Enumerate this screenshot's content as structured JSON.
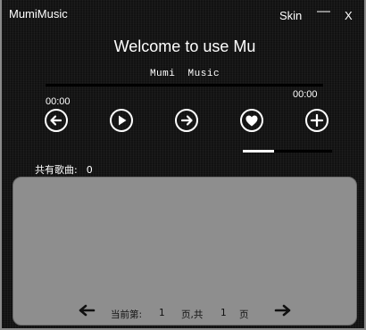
{
  "window": {
    "title": "MumiMusic",
    "skin_label": "Skin",
    "minimize_label": "—",
    "close_label": "X"
  },
  "header": {
    "welcome": "Welcome to use Mu",
    "song_title": "Mumi  Music"
  },
  "player": {
    "time_current": "00:00",
    "time_total": "00:00",
    "progress_fraction": 0,
    "volume_fraction": 0.35,
    "controls": [
      {
        "name": "previous-button",
        "icon": "arrow-left-circle-icon"
      },
      {
        "name": "play-button",
        "icon": "play-circle-icon"
      },
      {
        "name": "next-button",
        "icon": "arrow-right-circle-icon"
      },
      {
        "name": "favorite-button",
        "icon": "heart-circle-icon"
      },
      {
        "name": "add-button",
        "icon": "plus-circle-icon"
      }
    ]
  },
  "playlist": {
    "count_label": "共有歌曲:",
    "count_value": "0",
    "items": []
  },
  "pager": {
    "prefix": "当前第:",
    "current_page": "1",
    "middle": "页,共",
    "total_pages": "1",
    "suffix": "页",
    "prev_icon": "arrow-left-icon",
    "next_icon": "arrow-right-icon"
  },
  "colors": {
    "background": "#161616",
    "playlist_panel": "#8e8e8e",
    "text": "#ffffff",
    "progress_track": "#000000",
    "volume_fill": "#ffffff"
  }
}
